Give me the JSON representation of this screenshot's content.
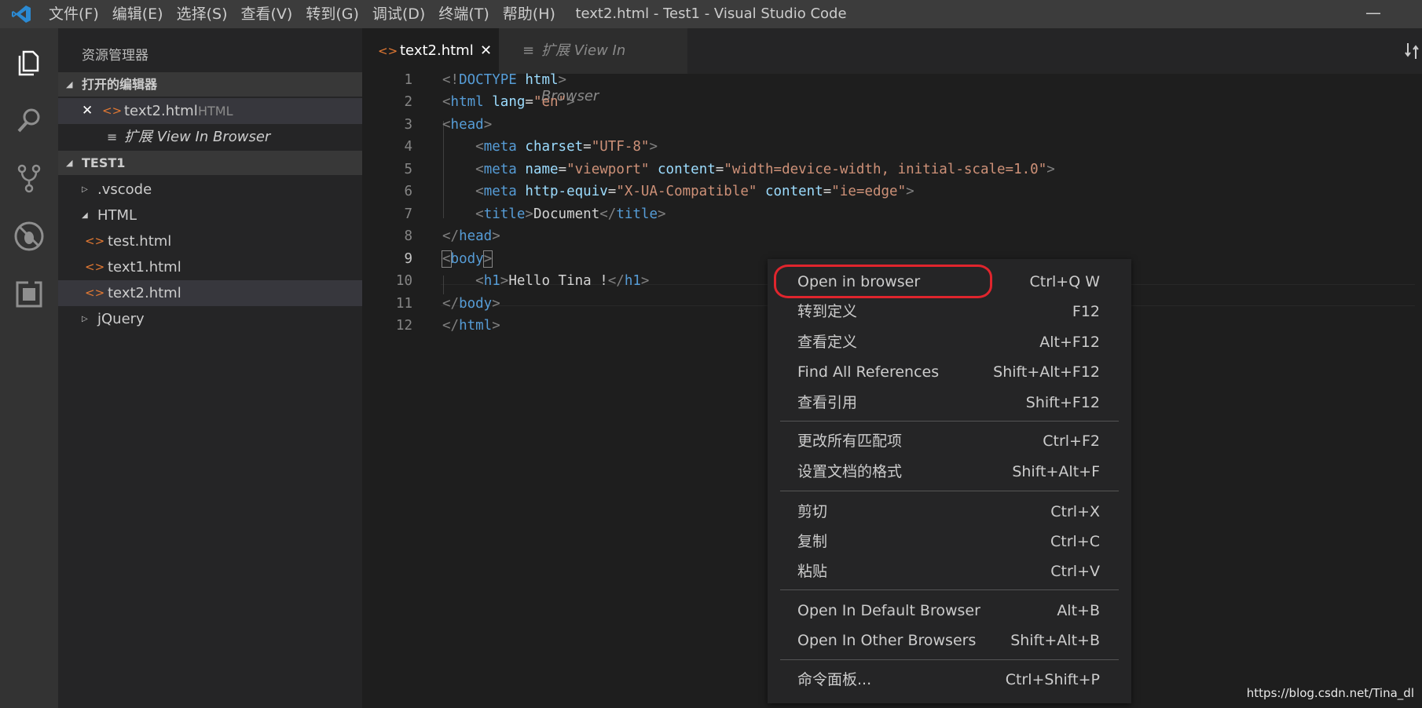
{
  "window": {
    "title": "text2.html - Test1 - Visual Studio Code",
    "minimize": "—"
  },
  "menu": [
    "文件(F)",
    "编辑(E)",
    "选择(S)",
    "查看(V)",
    "转到(G)",
    "调试(D)",
    "终端(T)",
    "帮助(H)"
  ],
  "activity_icons": [
    "files-icon",
    "search-icon",
    "source-control-icon",
    "debug-icon",
    "extensions-icon"
  ],
  "sidebar": {
    "title": "资源管理器",
    "open_editors": {
      "label": "打开的编辑器",
      "items": [
        {
          "name": "text2.html",
          "lang": "HTML"
        },
        {
          "name": "扩展 View In Browser"
        }
      ]
    },
    "workspace": {
      "label": "TEST1",
      "items": [
        {
          "name": ".vscode"
        },
        {
          "name": "HTML"
        },
        {
          "name": "test.html"
        },
        {
          "name": "text1.html"
        },
        {
          "name": "text2.html"
        },
        {
          "name": "jQuery"
        }
      ]
    }
  },
  "tabs": [
    {
      "label": "text2.html",
      "close": "✕"
    },
    {
      "label": "扩展 View In Browser"
    }
  ],
  "code": {
    "line_numbers": [
      "1",
      "2",
      "3",
      "4",
      "5",
      "6",
      "7",
      "8",
      "9",
      "10",
      "11",
      "12"
    ]
  },
  "context_menu": {
    "items": [
      {
        "label": "Open in browser",
        "shortcut": "Ctrl+Q W"
      },
      {
        "label": "转到定义",
        "shortcut": "F12"
      },
      {
        "label": "查看定义",
        "shortcut": "Alt+F12"
      },
      {
        "label": "Find All References",
        "shortcut": "Shift+Alt+F12"
      },
      {
        "label": "查看引用",
        "shortcut": "Shift+F12"
      },
      {
        "label": "更改所有匹配项",
        "shortcut": "Ctrl+F2"
      },
      {
        "label": "设置文档的格式",
        "shortcut": "Shift+Alt+F"
      },
      {
        "label": "剪切",
        "shortcut": "Ctrl+X"
      },
      {
        "label": "复制",
        "shortcut": "Ctrl+C"
      },
      {
        "label": "粘贴",
        "shortcut": "Ctrl+V"
      },
      {
        "label": "Open In Default Browser",
        "shortcut": "Alt+B"
      },
      {
        "label": "Open In Other Browsers",
        "shortcut": "Shift+Alt+B"
      },
      {
        "label": "命令面板...",
        "shortcut": "Ctrl+Shift+P"
      }
    ]
  },
  "watermark": "https://blog.csdn.net/Tina_dl",
  "colors": {
    "accent": "#007acc",
    "highlight_circle": "#e0252d"
  }
}
